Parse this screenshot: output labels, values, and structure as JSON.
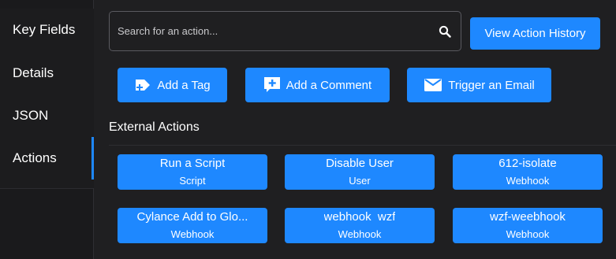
{
  "sidebar": {
    "items": [
      {
        "label": "Key Fields"
      },
      {
        "label": "Details"
      },
      {
        "label": "JSON"
      },
      {
        "label": "Actions",
        "active": true
      }
    ]
  },
  "search": {
    "placeholder": "Search for an action...",
    "value": "",
    "icon": "search-icon"
  },
  "toolbar": {
    "history_label": "View Action History"
  },
  "quick_actions": [
    {
      "label": "Add a Tag",
      "icon": "tag-add-icon"
    },
    {
      "label": "Add a Comment",
      "icon": "comment-add-icon"
    },
    {
      "label": "Trigger an Email",
      "icon": "email-icon"
    }
  ],
  "external": {
    "title": "External Actions",
    "actions": [
      {
        "name": "Run a Script",
        "type": "Script"
      },
      {
        "name": "Disable User",
        "type": "User"
      },
      {
        "name": "612-isolate",
        "type": "Webhook"
      },
      {
        "name": "Cylance Add to Glo...",
        "type": "Webhook"
      },
      {
        "name": "webhook  wzf",
        "type": "Webhook"
      },
      {
        "name": "wzf-weebhook",
        "type": "Webhook"
      }
    ]
  },
  "colors": {
    "accent": "#1e88ff",
    "background": "#1f1f21",
    "sidebar": "#1a1a1c"
  }
}
